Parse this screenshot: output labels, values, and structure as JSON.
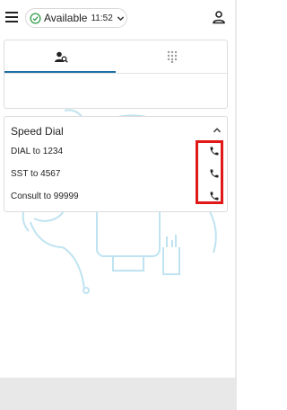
{
  "header": {
    "status_label": "Available",
    "status_time": "11:52",
    "status_color": "#2e9b48",
    "icons": [
      "menu-icon",
      "check-circle-icon",
      "chevron-down-icon",
      "person-icon"
    ]
  },
  "tabs": [
    {
      "name": "dialer-search",
      "icon": "person-search-icon",
      "active": true
    },
    {
      "name": "keypad",
      "icon": "dialpad-icon",
      "active": false
    }
  ],
  "speed_dial": {
    "title": "Speed Dial",
    "collapse_icon": "chevron-up-icon",
    "items": [
      {
        "label": "DIAL to 1234",
        "icon": "phone-icon"
      },
      {
        "label": "SST to 4567",
        "icon": "phone-icon"
      },
      {
        "label": "Consult to 99999",
        "icon": "phone-icon"
      }
    ]
  },
  "colors": {
    "accent": "#1f6fa8",
    "highlight": "#e01818",
    "illustration": "#bfe3f0"
  }
}
